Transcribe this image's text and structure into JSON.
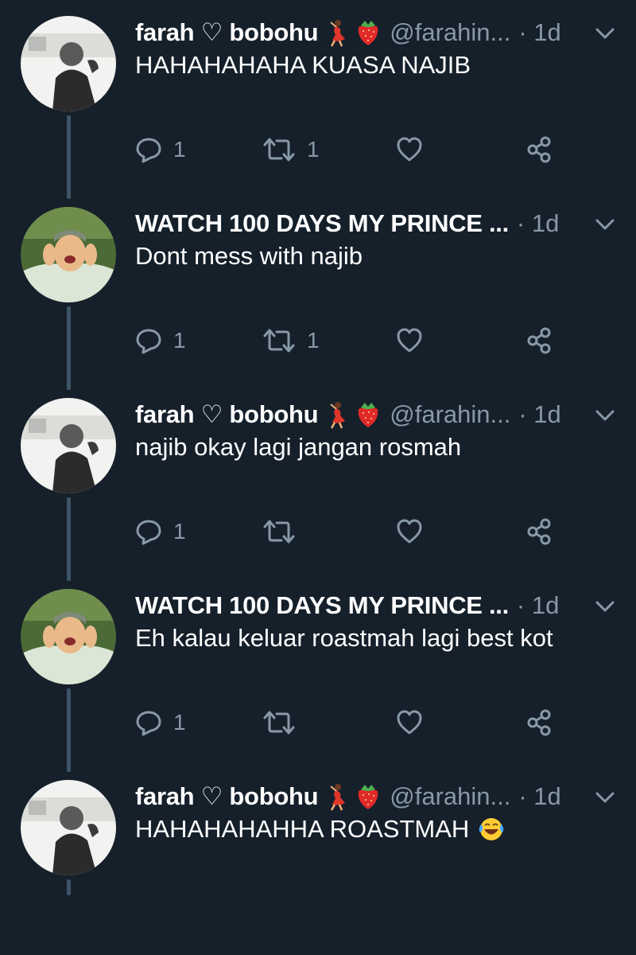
{
  "tweets": [
    {
      "display_name": "farah ♡ bobohu",
      "handle": "@farahin...",
      "time": "· 1d",
      "text": "HAHAHAHAHA KUASA NAJIB",
      "reply_count": "1",
      "retweet_count": "1",
      "like_count": ""
    },
    {
      "display_name": "WATCH 100 DAYS MY PRINCE ...",
      "handle": "",
      "time": "· 1d",
      "text": "Dont mess with najib",
      "reply_count": "1",
      "retweet_count": "1",
      "like_count": ""
    },
    {
      "display_name": "farah ♡ bobohu",
      "handle": "@farahin...",
      "time": "· 1d",
      "text": "najib okay lagi jangan rosmah",
      "reply_count": "1",
      "retweet_count": "",
      "like_count": ""
    },
    {
      "display_name": "WATCH 100 DAYS MY PRINCE ...",
      "handle": "",
      "time": "· 1d",
      "text": "Eh kalau keluar roastmah lagi best kot",
      "reply_count": "1",
      "retweet_count": "",
      "like_count": ""
    },
    {
      "display_name": "farah ♡ bobohu",
      "handle": "@farahin...",
      "time": "· 1d",
      "text": "HAHAHAHAHHA ROASTMAH",
      "reply_count": "",
      "retweet_count": "",
      "like_count": ""
    }
  ],
  "icons": {
    "reply": "reply-icon",
    "retweet": "retweet-icon",
    "like": "heart-icon",
    "share": "share-icon",
    "caret": "chevron-down-icon",
    "dancer": "dancer-emoji",
    "strawberry": "strawberry-emoji",
    "laughing": "tears-of-joy-emoji"
  },
  "colors": {
    "background": "#15202b",
    "text": "#ffffff",
    "secondary": "#8899a6",
    "thread_line": "#3d5466"
  }
}
